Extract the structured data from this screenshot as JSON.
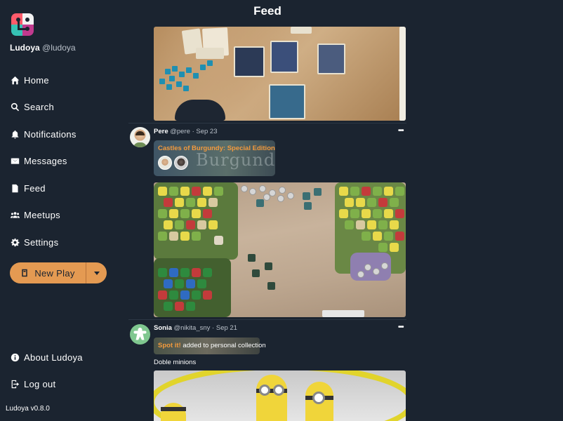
{
  "app": {
    "name": "Ludoya",
    "handle": "@ludoya",
    "version": "Ludoya v0.8.0"
  },
  "nav": {
    "items": [
      {
        "label": "Home",
        "icon": "home-icon"
      },
      {
        "label": "Search",
        "icon": "search-icon"
      },
      {
        "label": "Notifications",
        "icon": "bell-icon"
      },
      {
        "label": "Messages",
        "icon": "envelope-icon"
      },
      {
        "label": "Feed",
        "icon": "document-icon"
      },
      {
        "label": "Meetups",
        "icon": "group-icon"
      },
      {
        "label": "Settings",
        "icon": "gear-icon"
      }
    ],
    "new_play_label": "New Play",
    "about_label": "About Ludoya",
    "logout_label": "Log out"
  },
  "header": {
    "title": "Feed"
  },
  "posts": [
    {
      "author": "Pere",
      "handle": "@pere",
      "date": "Sep 23",
      "game": "Castles of Burgundy: Special Edition",
      "action": " play",
      "box_art_text": "Burgundy"
    },
    {
      "author": "Sonia",
      "handle": "@nikita_sny",
      "date": "Sep 21",
      "game": "Spot it!",
      "action": " added to personal collection",
      "comment": "Doble minions"
    }
  ],
  "colors": {
    "background": "#1b2430",
    "accent": "#e49a52",
    "game_link": "#f39a3d",
    "muted_text": "#b9c0c9"
  }
}
